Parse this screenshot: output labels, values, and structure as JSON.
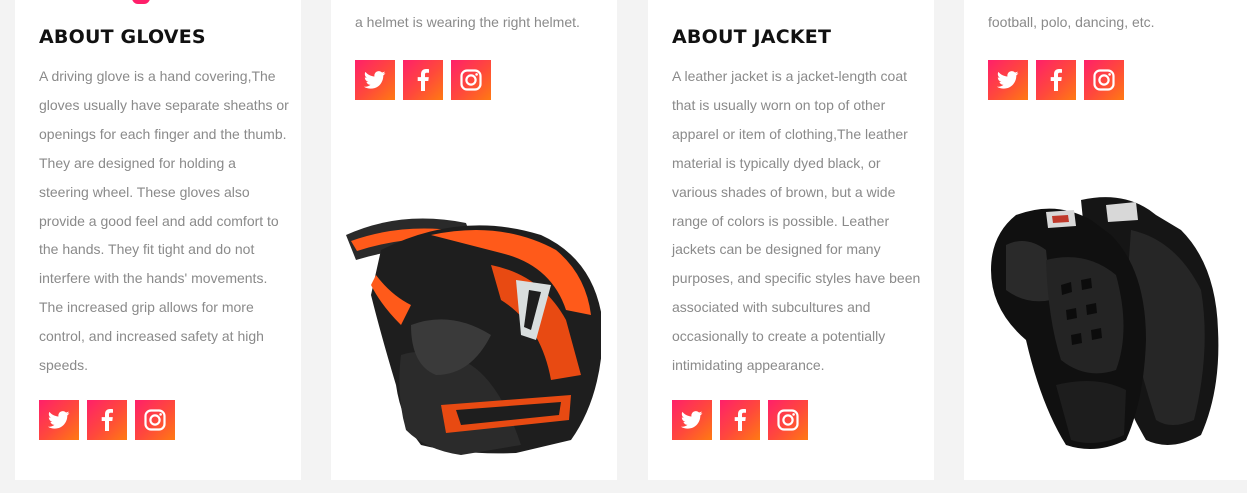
{
  "cards": {
    "gloves": {
      "title": "ABOUT GLOVES",
      "text": "A driving glove is a hand covering,The gloves usually have separate sheaths or openings for each finger and the thumb. They are designed for holding a steering wheel. These gloves also provide a good feel and add comfort to the hands. They fit tight and do not interfere with the hands' movements. The increased grip allows for more control, and increased safety at high speeds."
    },
    "helmet": {
      "top_text": "a helmet is wearing the right helmet."
    },
    "jacket": {
      "title": "ABOUT JACKET",
      "text": "A leather jacket is a jacket-length coat that is usually worn on top of other apparel or item of clothing,The leather material is typically dyed black, or various shades of brown, but a wide range of colors is possible. Leather jackets can be designed for many purposes, and specific styles have been associated with subcultures and occasionally to create a potentially intimidating appearance."
    },
    "pads": {
      "top_text": "football, polo, dancing, etc."
    }
  },
  "social_icons": [
    "twitter-icon",
    "facebook-icon",
    "instagram-icon"
  ],
  "colors": {
    "gradient_start": "#ff1f6a",
    "gradient_end": "#ff7a12",
    "page_bg": "#f3f3f3",
    "card_bg": "#ffffff",
    "title": "#111111",
    "body_text": "#8a8a8a"
  }
}
